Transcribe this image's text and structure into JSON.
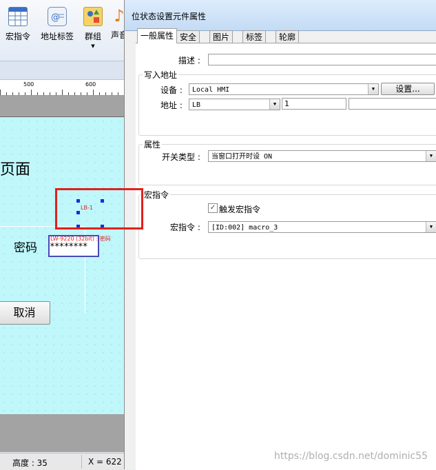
{
  "toolbar": {
    "items": [
      {
        "label": "宏指令",
        "icon": "table-icon"
      },
      {
        "label": "地址标签",
        "icon": "at-tag-icon"
      },
      {
        "label": "群组",
        "icon": "group-icon"
      },
      {
        "label": "声音",
        "icon": "music-note-icon"
      }
    ]
  },
  "ruler": {
    "marks": [
      "500",
      "600"
    ]
  },
  "canvas": {
    "page_title_fragment": "页面",
    "password_label": "密码",
    "password_value": "********",
    "password_caption": "LW-9220 (32bit) : 密码",
    "selected_element_label": "LB-1",
    "cancel_button": "取消"
  },
  "statusbar": {
    "height_text": "高度 : 35",
    "x_text": "X = 622"
  },
  "dialog": {
    "title": "位状态设置元件属性",
    "tabs": [
      "一般属性",
      "安全",
      "图片",
      "标签",
      "轮廓"
    ],
    "active_tab": 0,
    "description_label": "描述 :",
    "description_value": "",
    "write_address": {
      "group_label": "写入地址",
      "device_label": "设备 :",
      "device_value": "Local HMI",
      "settings_button": "设置...",
      "address_label": "地址 :",
      "address_type": "LB",
      "address_value": "1",
      "address_extra": ""
    },
    "properties": {
      "group_label": "属性",
      "switch_type_label": "开关类型 :",
      "switch_type_value": "当窗口打开时设 ON"
    },
    "macro": {
      "group_label": "宏指令",
      "trigger_checkbox_label": "触发宏指令",
      "trigger_checked": true,
      "macro_label": "宏指令 :",
      "macro_value": "[ID:002] macro_3"
    }
  },
  "watermark": "https://blog.csdn.net/dominic55",
  "colors": {
    "canvas_bg": "#bff7fb",
    "highlight_box": "#e0201b",
    "selection_handle": "#1d2bd6",
    "caption_red": "#e0201b"
  }
}
